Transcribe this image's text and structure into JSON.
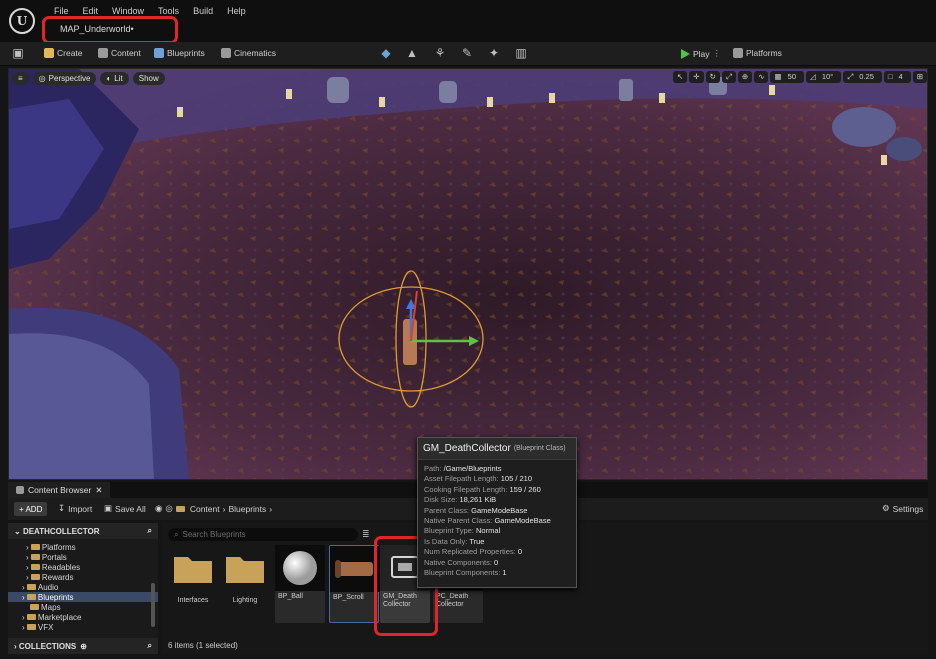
{
  "titlebar": {
    "menu": [
      "File",
      "Edit",
      "Window",
      "Tools",
      "Build",
      "Help"
    ],
    "map_tab": "MAP_Underworld•"
  },
  "toolbar": {
    "create_label": "Create",
    "content_label": "Content",
    "blueprints_label": "Blueprints",
    "cinematics_label": "Cinematics",
    "play_label": "Play",
    "platforms_label": "Platforms"
  },
  "viewport": {
    "perspective_label": "Perspective",
    "lit_label": "Lit",
    "show_label": "Show",
    "grid_value": "50",
    "angle_value": "10°",
    "scale_value": "0.25",
    "camera_speed": "4"
  },
  "content_browser": {
    "tab_label": "Content Browser",
    "add_label": "+ ADD",
    "import_label": "Import",
    "save_all_label": "Save All",
    "breadcrumb": [
      "Content",
      "Blueprints"
    ],
    "settings_label": "Settings",
    "search_placeholder": "Search Blueprints",
    "tree_root": "DEATHCOLLECTOR",
    "tree_items": [
      "Platforms",
      "Portals",
      "Readables",
      "Rewards",
      "Audio",
      "Blueprints",
      "Maps",
      "Marketplace",
      "VFX"
    ],
    "collections_label": "COLLECTIONS",
    "assets": [
      {
        "label": "Interfaces"
      },
      {
        "label": "Lighting"
      },
      {
        "label": "BP_Ball"
      },
      {
        "label": "BP_Scroll"
      },
      {
        "label": "GM_Death Collector"
      },
      {
        "label": "PC_Death Collector"
      }
    ],
    "status": "6 items (1 selected)"
  },
  "tooltip": {
    "title": "GM_DeathCollector",
    "subtitle": "(Blueprint Class)",
    "rows": [
      {
        "k": "Path:",
        "v": "/Game/Blueprints"
      },
      {
        "k": "Asset Filepath Length:",
        "v": "105 / 210"
      },
      {
        "k": "Cooking Filepath Length:",
        "v": "159 / 260"
      },
      {
        "k": "Disk Size:",
        "v": "18,261 KiB"
      },
      {
        "k": "Parent Class:",
        "v": "GameModeBase"
      },
      {
        "k": "Native Parent Class:",
        "v": "GameModeBase"
      },
      {
        "k": "Blueprint Type:",
        "v": "Normal"
      },
      {
        "k": "Is Data Only:",
        "v": "True"
      },
      {
        "k": "Num Replicated Properties:",
        "v": "0"
      },
      {
        "k": "Native Components:",
        "v": "0"
      },
      {
        "k": "Blueprint Components:",
        "v": "1"
      }
    ]
  },
  "colors": {
    "accent_red": "#e0262b",
    "play_green": "#4ec14a",
    "folder": "#c8a259"
  }
}
